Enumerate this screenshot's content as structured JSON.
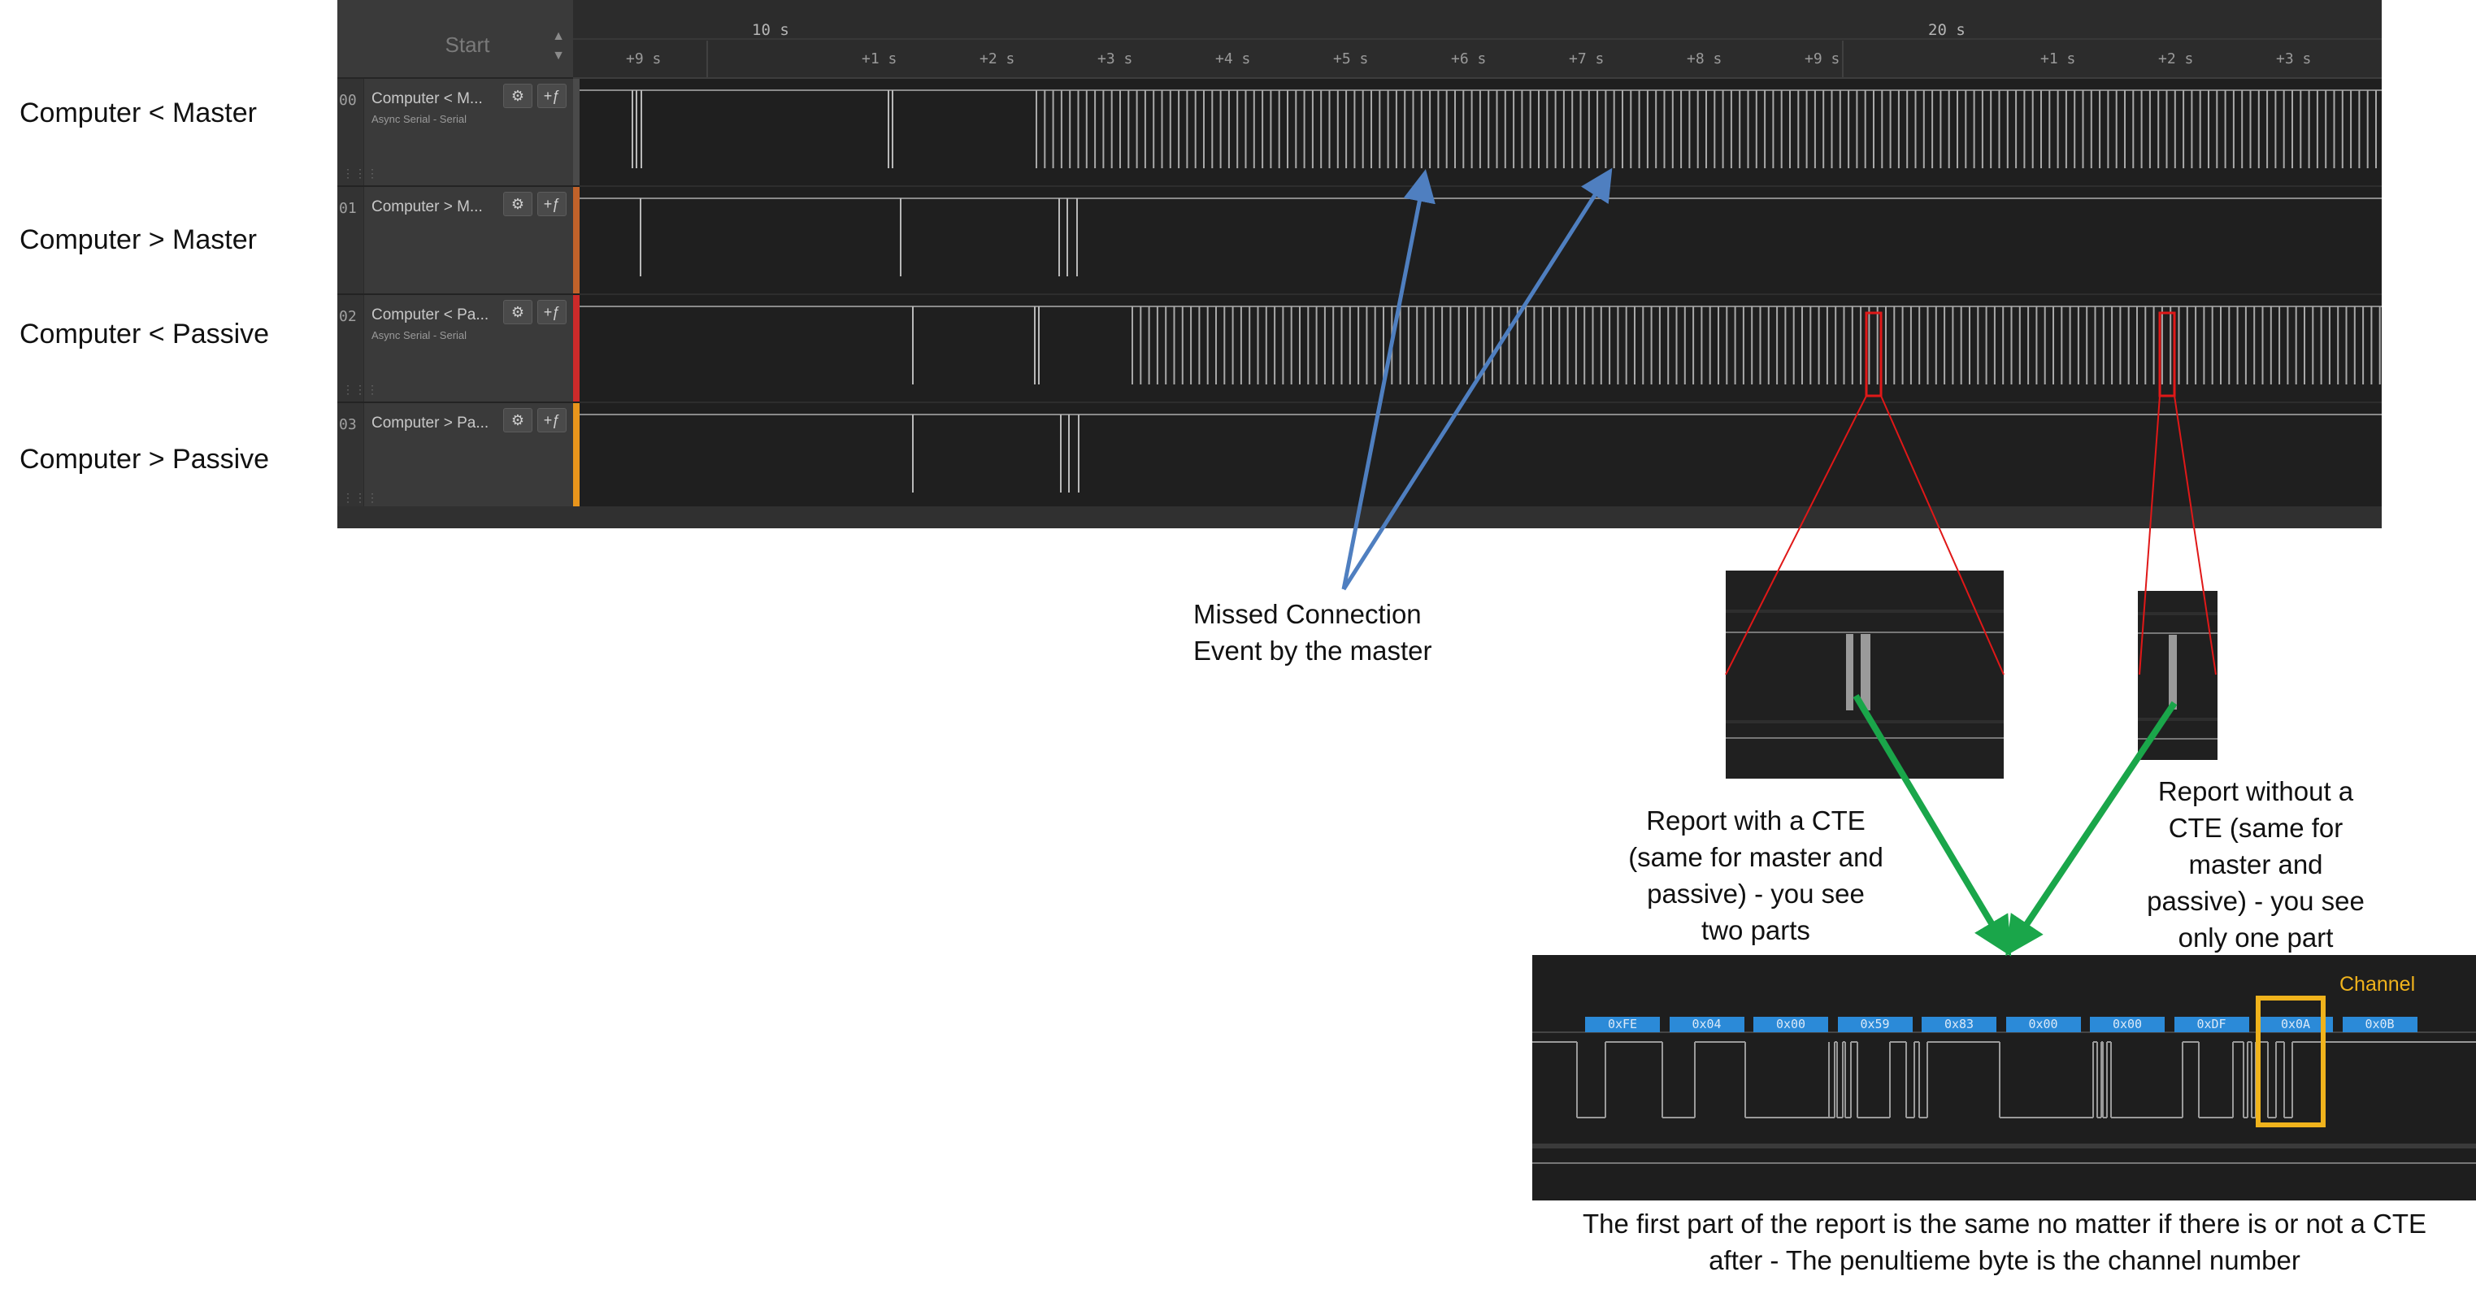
{
  "side_labels": [
    "Computer < Master",
    "Computer > Master",
    "Computer < Passive",
    "Computer > Passive"
  ],
  "ruler": {
    "start_label": "Start",
    "major_ticks": [
      "10 s",
      "20 s"
    ],
    "minor_ticks": [
      "+9 s",
      "+1 s",
      "+2 s",
      "+3 s",
      "+4 s",
      "+5 s",
      "+6 s",
      "+7 s",
      "+8 s",
      "+9 s",
      "+1 s",
      "+2 s",
      "+3 s"
    ]
  },
  "channels": [
    {
      "index": "00",
      "name": "Computer < M...",
      "sub": "Async Serial - Serial",
      "color": "#4a4a4a"
    },
    {
      "index": "01",
      "name": "Computer > M...",
      "sub": "",
      "color": "#c0622a"
    },
    {
      "index": "02",
      "name": "Computer < Pa...",
      "sub": "Async Serial - Serial",
      "color": "#cc2a2a"
    },
    {
      "index": "03",
      "name": "Computer > Pa...",
      "sub": "",
      "color": "#e8951c"
    }
  ],
  "icons": {
    "settings": "gear-icon",
    "add_analyzer": "add-analyzer-icon"
  },
  "annotations": {
    "missed_event": [
      "Missed Connection",
      "Event by the master"
    ],
    "report_with_cte": [
      "Report with a CTE",
      "(same for master and",
      "passive) - you see",
      "two parts"
    ],
    "report_without_cte": [
      "Report without a",
      "CTE (same for",
      "master and",
      "passive) - you see",
      "only one part"
    ],
    "bottom_note": [
      "The first part of the report is the same no matter if there is or not a CTE",
      "after - The penultieme byte is the channel number"
    ],
    "channel_label": "Channel"
  },
  "decoded_bytes": [
    "0xFE",
    "0x04",
    "0x00",
    "0x59",
    "0x83",
    "0x00",
    "0x00",
    "0xDF",
    "0x0A",
    "0x0B"
  ],
  "colors": {
    "arrow_blue": "#4f7fc0",
    "arrow_green": "#1aa64a",
    "callout_red": "#e01818",
    "highlight_yellow": "#f0b31c",
    "byte_blue": "#2b8ad8"
  }
}
